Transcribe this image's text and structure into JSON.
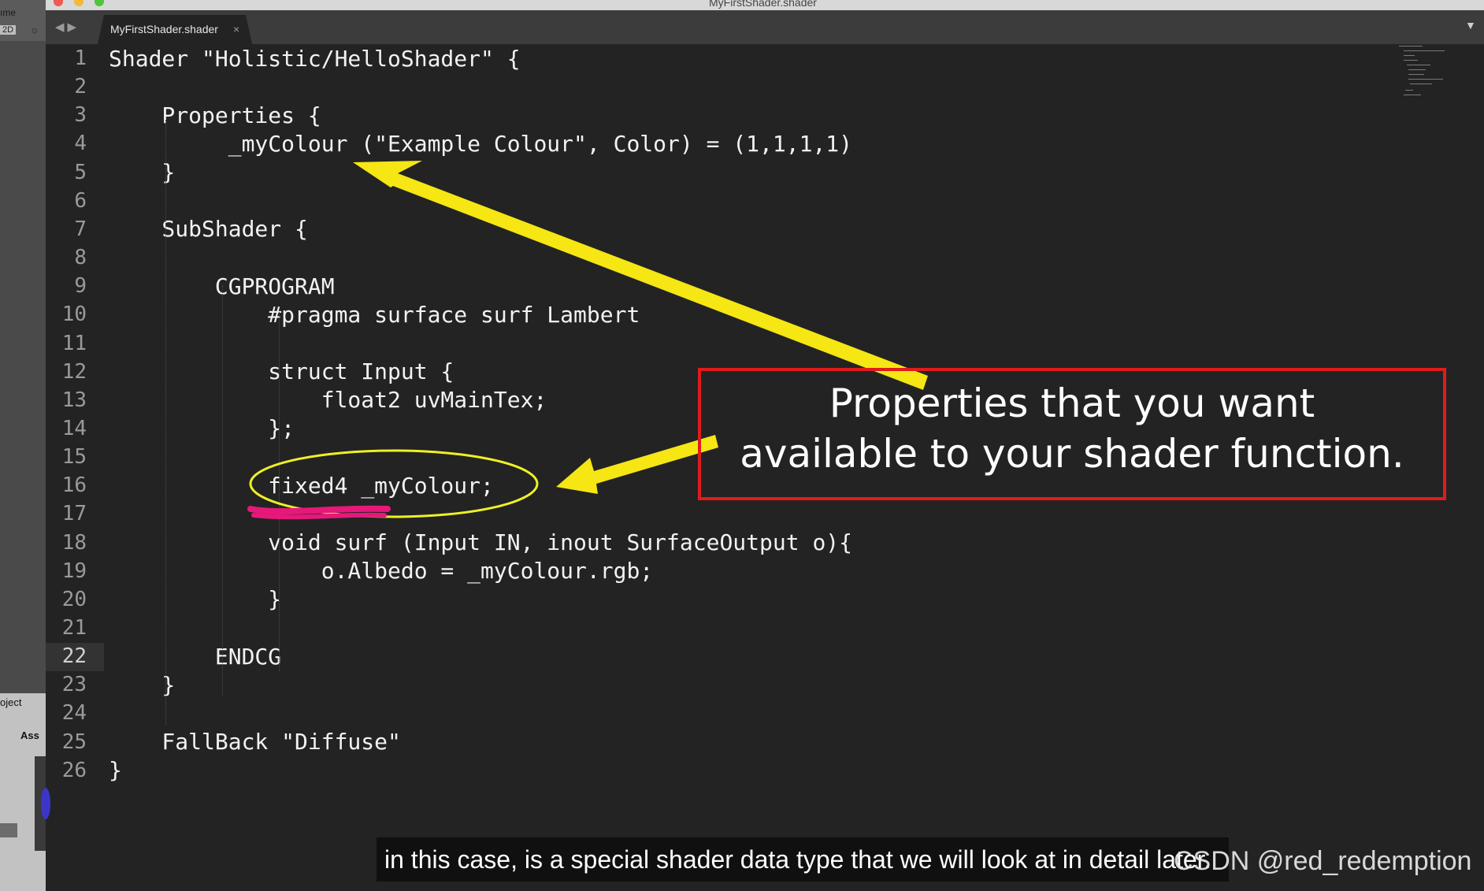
{
  "window": {
    "title": "MyFirstShader.shader"
  },
  "unity": {
    "name_fragment": "ıme",
    "mode_2d": "2D",
    "project_tab": "oject",
    "assets_label": "Ass"
  },
  "tabs": [
    {
      "label": "MyFirstShader.shader",
      "close": "×"
    }
  ],
  "editor": {
    "current_line": 22,
    "lines": [
      {
        "n": "1",
        "text": "Shader \"Holistic/HelloShader\" {"
      },
      {
        "n": "2",
        "text": ""
      },
      {
        "n": "3",
        "text": "    Properties {"
      },
      {
        "n": "4",
        "text": "         _myColour (\"Example Colour\", Color) = (1,1,1,1)"
      },
      {
        "n": "5",
        "text": "    }"
      },
      {
        "n": "6",
        "text": ""
      },
      {
        "n": "7",
        "text": "    SubShader {"
      },
      {
        "n": "8",
        "text": ""
      },
      {
        "n": "9",
        "text": "        CGPROGRAM"
      },
      {
        "n": "10",
        "text": "            #pragma surface surf Lambert"
      },
      {
        "n": "11",
        "text": ""
      },
      {
        "n": "12",
        "text": "            struct Input {"
      },
      {
        "n": "13",
        "text": "                float2 uvMainTex;"
      },
      {
        "n": "14",
        "text": "            };"
      },
      {
        "n": "15",
        "text": ""
      },
      {
        "n": "16",
        "text": "            fixed4 _myColour;"
      },
      {
        "n": "17",
        "text": ""
      },
      {
        "n": "18",
        "text": "            void surf (Input IN, inout SurfaceOutput o){"
      },
      {
        "n": "19",
        "text": "                o.Albedo = _myColour.rgb;"
      },
      {
        "n": "20",
        "text": "            }"
      },
      {
        "n": "21",
        "text": ""
      },
      {
        "n": "22",
        "text": "        ENDCG"
      },
      {
        "n": "23",
        "text": "    }"
      },
      {
        "n": "24",
        "text": ""
      },
      {
        "n": "25",
        "text": "    FallBack \"Diffuse\""
      },
      {
        "n": "26",
        "text": "}"
      }
    ]
  },
  "annotation": {
    "callout_line1": "Properties that you want",
    "callout_line2": "available to your shader function.",
    "arrow_color": "#f5e614",
    "box_color": "#e01b1b",
    "highlight_color": "#e6187a"
  },
  "subtitle": "in this case, is a special shader data type that we will look at in detail later.",
  "watermark": "CSDN @red_redemption"
}
